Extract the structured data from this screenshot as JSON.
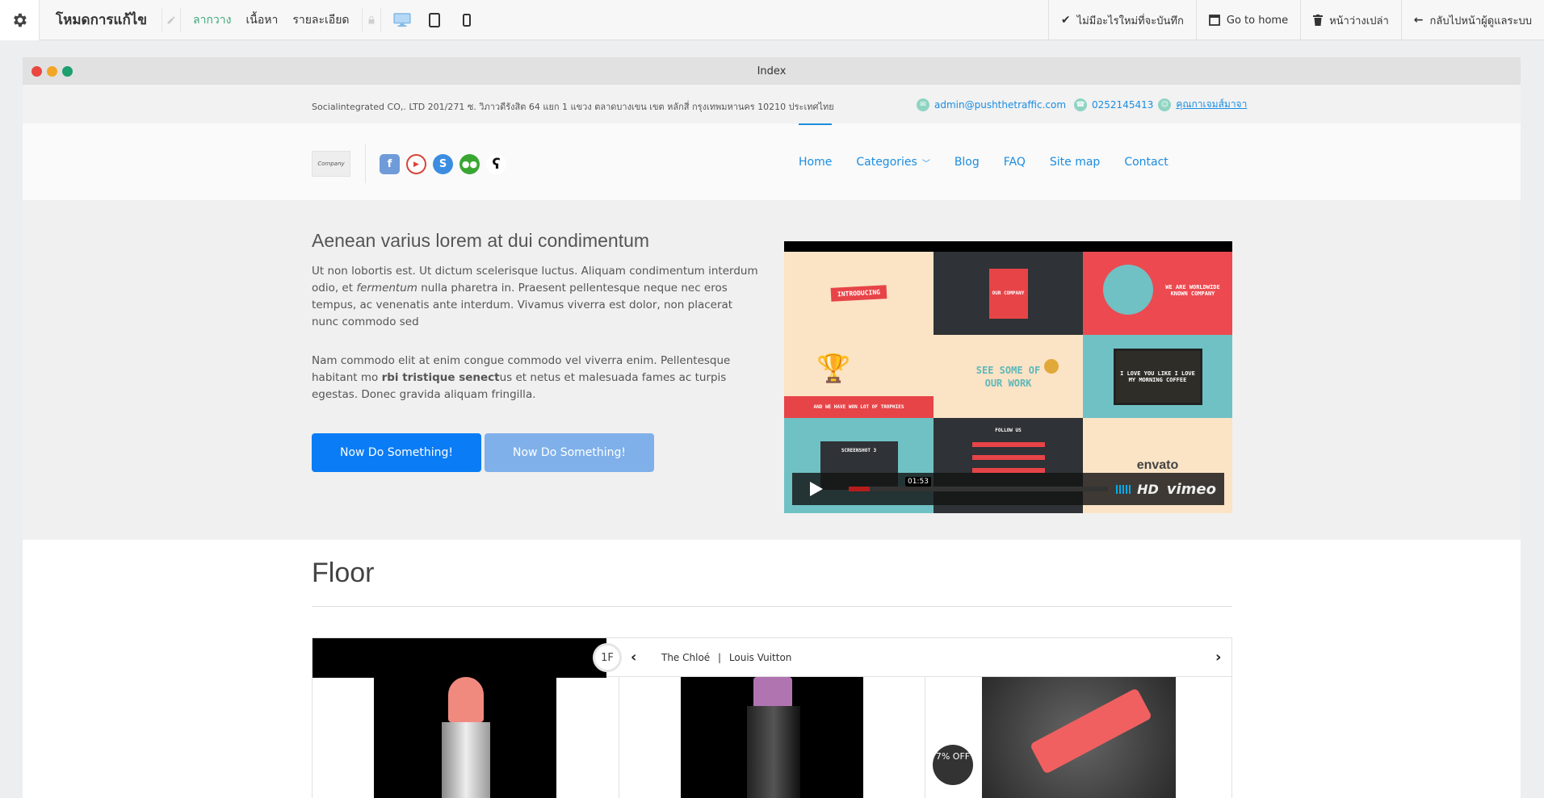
{
  "editor": {
    "title": "โหมดการแก้ไข",
    "tabs": [
      {
        "label": "ลากวาง",
        "active": true
      },
      {
        "label": "เนื้อหา",
        "active": false
      },
      {
        "label": "รายละเอียด",
        "active": false
      }
    ],
    "actions": {
      "save": "ไม่มีอะไรใหม่ที่จะบันทึก",
      "home": "Go to home",
      "blank": "หน้าว่างเปล่า",
      "back": "กลับไปหน้าผู้ดูแลระบบ"
    },
    "accent": "#3da77a"
  },
  "frame": {
    "title": "Index"
  },
  "topbar": {
    "address": "Socialintegrated CO,. LTD   201/271 ซ. วิภาวดีรังสิต 64 แยก 1 แขวง ตลาดบางเขน เขต หลักสี่ กรุงเทพมหานคร 10210 ประเทศไทย",
    "email": "admin@pushthetraffic.com",
    "phone": "0252145413",
    "contact": "คุณกาเจมส์มาจา"
  },
  "header": {
    "logo_text": "Company",
    "nav": [
      "Home",
      "Categories",
      "Blog",
      "FAQ",
      "Site map",
      "Contact"
    ]
  },
  "hero": {
    "title": "Aenean varius lorem at dui condimentum",
    "p1_a": "Ut non lobortis est. Ut dictum scelerisque luctus. Aliquam condimentum interdum odio, et ",
    "p1_em": "fermentum",
    "p1_b": " nulla pharetra in. Praesent pellentesque neque nec eros tempus, ac venenatis ante interdum. Vivamus viverra est dolor, non placerat nunc commodo sed",
    "p2_a": "Nam commodo elit at enim congue commodo vel viverra enim. Pellentesque habitant mo ",
    "p2_strong": "rbi tristique senect",
    "p2_b": "us et netus et malesuada fames ac turpis egestas. Donec gravida aliquam fringilla.",
    "btn_primary": "Now Do Something!",
    "btn_secondary": "Now Do Something!"
  },
  "video": {
    "time": "01:53",
    "progress": 0.08,
    "hd": "HD",
    "brand": "vimeo",
    "tiles": [
      "INTRODUCING",
      "OUR COMPANY",
      "WE ARE WORLDWIDE KNOWN COMPANY",
      "AND WE HAVE WON LOT OF TROPHIES",
      "SEE SOME OF OUR WORK",
      "I LOVE YOU LIKE I LOVE MY MORNING COFFEE",
      "SCREENSHOT 3",
      "FOLLOW US",
      "envato"
    ]
  },
  "floor": {
    "title": "Floor",
    "badge": "1F",
    "brand1": "The Chloé",
    "brand_sep": "|",
    "brand2": "Louis Vuitton",
    "discount": "7% OFF"
  }
}
